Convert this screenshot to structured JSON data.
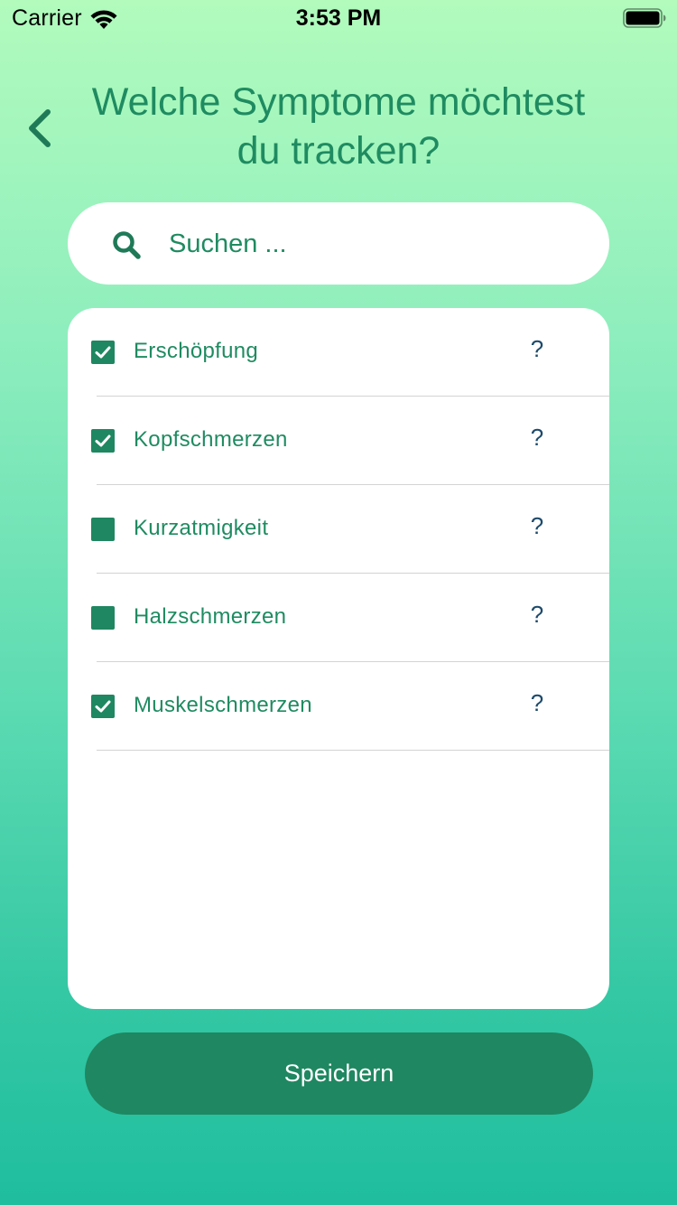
{
  "status_bar": {
    "carrier": "Carrier",
    "time": "3:53 PM",
    "wifi_icon": "wifi-icon",
    "battery_icon": "battery-full-icon"
  },
  "header": {
    "back_icon": "chevron-left-icon",
    "title": "Welche Symptome möchtest du tracken?"
  },
  "search": {
    "icon": "search-icon",
    "placeholder": "Suchen ...",
    "value": ""
  },
  "symptoms": [
    {
      "label": "Erschöpfung",
      "checked": true,
      "help": "?"
    },
    {
      "label": "Kopfschmerzen",
      "checked": true,
      "help": "?"
    },
    {
      "label": "Kurzatmigkeit",
      "checked": false,
      "help": "?"
    },
    {
      "label": "Halzschmerzen",
      "checked": false,
      "help": "?"
    },
    {
      "label": "Muskelschmerzen",
      "checked": true,
      "help": "?"
    }
  ],
  "save_button": {
    "label": "Speichern"
  },
  "colors": {
    "accent": "#1f8761",
    "text_green": "#1f8b61",
    "help_text": "#1d4a6b",
    "gradient_top": "#b2fbbd",
    "gradient_bottom": "#1fbe9f"
  }
}
